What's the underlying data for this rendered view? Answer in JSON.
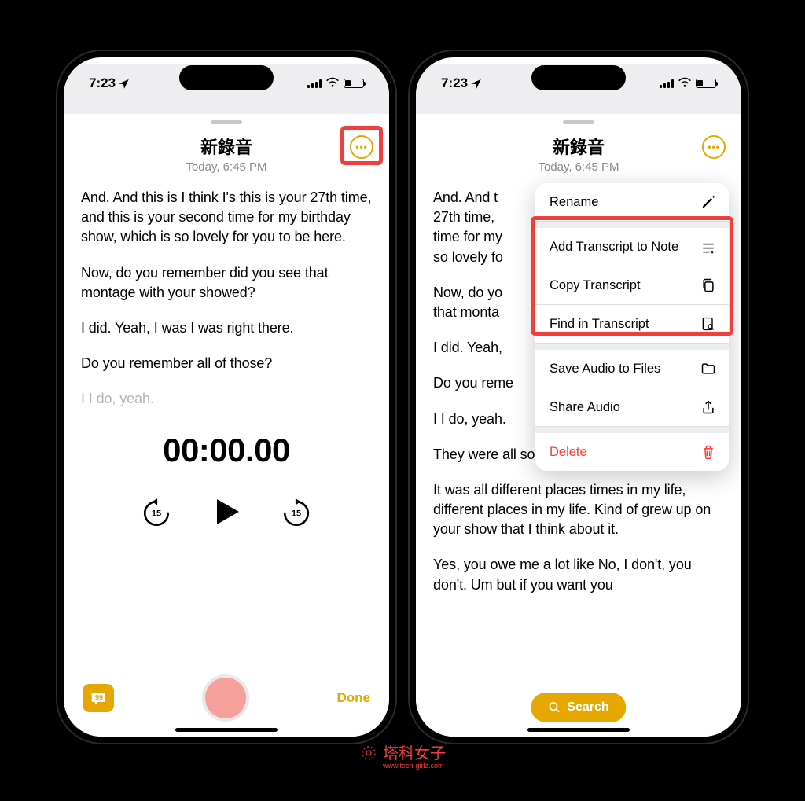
{
  "status": {
    "time": "7:23"
  },
  "header": {
    "title": "新錄音",
    "subtitle": "Today, 6:45 PM"
  },
  "transcript1": {
    "p1": "And. And this is I think I's this is your 27th time, and this is your second time for my birthday show, which is so lovely for you to be here.",
    "p2": "Now, do you remember did you see that montage with your showed?",
    "p3": "I did. Yeah, I was I was right there.",
    "p4": "Do you remember all of those?",
    "p5": "I I do, yeah."
  },
  "transcript2": {
    "p1a": "And. And t",
    "p1b": "27th time,",
    "p1c": "time for my",
    "p1d": "so lovely fo",
    "p2a": "Now, do yo",
    "p2b": "that monta",
    "p3a": "I did. Yeah,",
    "p4a": "Do you reme",
    "p5a": "I I do, yeah.",
    "p6": "They were all so different.",
    "p7": "It was all different places times in my life, different places in my life. Kind of grew up on your show that I think about it.",
    "p8": "Yes, you owe me a lot like No, I don't, you don't. Um but if you want you"
  },
  "timer": "00:00.00",
  "skip": "15",
  "done": "Done",
  "menu": {
    "rename": "Rename",
    "add_note": "Add Transcript to Note",
    "copy": "Copy Transcript",
    "find": "Find in Transcript",
    "save": "Save Audio to Files",
    "share": "Share Audio",
    "delete": "Delete"
  },
  "search": "Search",
  "watermark": {
    "text": "塔科女子",
    "url": "www.tech-girlz.com"
  }
}
